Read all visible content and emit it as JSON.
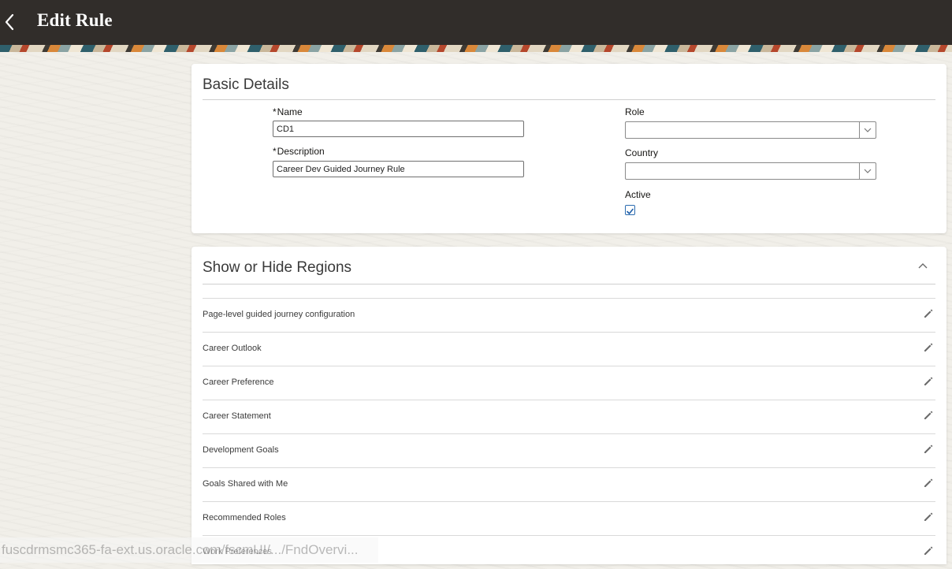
{
  "header": {
    "title": "Edit Rule",
    "back_icon": "chevron-left-icon"
  },
  "basic_details": {
    "title": "Basic Details",
    "required_marker": "*",
    "name_label": "Name",
    "name_value": "CD1",
    "description_label": "Description",
    "description_value": "Career Dev Guided Journey Rule",
    "role_label": "Role",
    "role_value": "",
    "country_label": "Country",
    "country_value": "",
    "active_label": "Active",
    "active_checked": true
  },
  "regions": {
    "title": "Show or Hide Regions",
    "collapse_icon": "chevron-up-icon",
    "edit_icon": "pencil-icon",
    "items": [
      {
        "label": "Page-level guided journey configuration"
      },
      {
        "label": "Career Outlook"
      },
      {
        "label": "Career Preference"
      },
      {
        "label": "Career Statement"
      },
      {
        "label": "Development Goals"
      },
      {
        "label": "Goals Shared with Me"
      },
      {
        "label": "Recommended Roles"
      },
      {
        "label": "Work Preferences"
      }
    ]
  },
  "status_bar": {
    "url": "fuscdrmsmc365-fa-ext.us.oracle.com/fscmUI/.../FndOvervi..."
  },
  "colors": {
    "header_bg": "#312d2a",
    "page_bg": "#f1efe9",
    "checkbox_accent": "#2b6cb0"
  }
}
